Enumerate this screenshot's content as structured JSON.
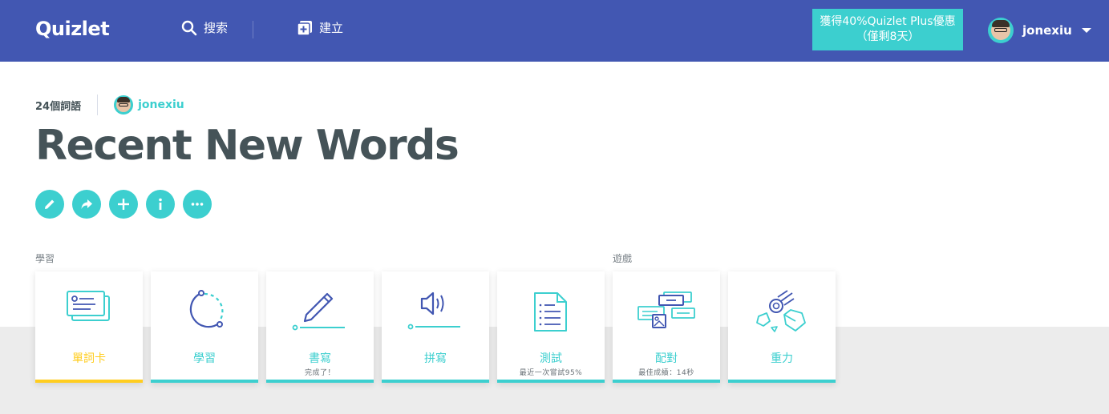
{
  "header": {
    "logo": "Quizlet",
    "search_label": "搜索",
    "create_label": "建立",
    "promo_line1": "獲得40%Quizlet Plus優惠",
    "promo_line2": "（僅剩8天）",
    "username": "jonexiu"
  },
  "set": {
    "term_count": "24個詞語",
    "author": "jonexiu",
    "title": "Recent New Words"
  },
  "actions": [
    "pencil-icon",
    "share-icon",
    "plus-icon",
    "info-icon",
    "more-icon"
  ],
  "sections": {
    "study": "學習",
    "games": "遊戲"
  },
  "modes": [
    {
      "label": "單詞卡",
      "sub": "",
      "icon": "flashcards-icon",
      "active": true
    },
    {
      "label": "學習",
      "sub": "",
      "icon": "learn-icon"
    },
    {
      "label": "書寫",
      "sub": "完成了！",
      "icon": "write-icon"
    },
    {
      "label": "拼寫",
      "sub": "",
      "icon": "spell-icon"
    },
    {
      "label": "測試",
      "sub": "最近一次嘗試95%",
      "icon": "test-icon"
    },
    {
      "label": "配對",
      "sub": "最佳成績：14秒",
      "icon": "match-icon"
    },
    {
      "label": "重力",
      "sub": "",
      "icon": "gravity-icon"
    }
  ],
  "colors": {
    "header_bg": "#4257b2",
    "accent": "#3ccfcf",
    "active": "#ffcd1f",
    "title": "#455358"
  }
}
